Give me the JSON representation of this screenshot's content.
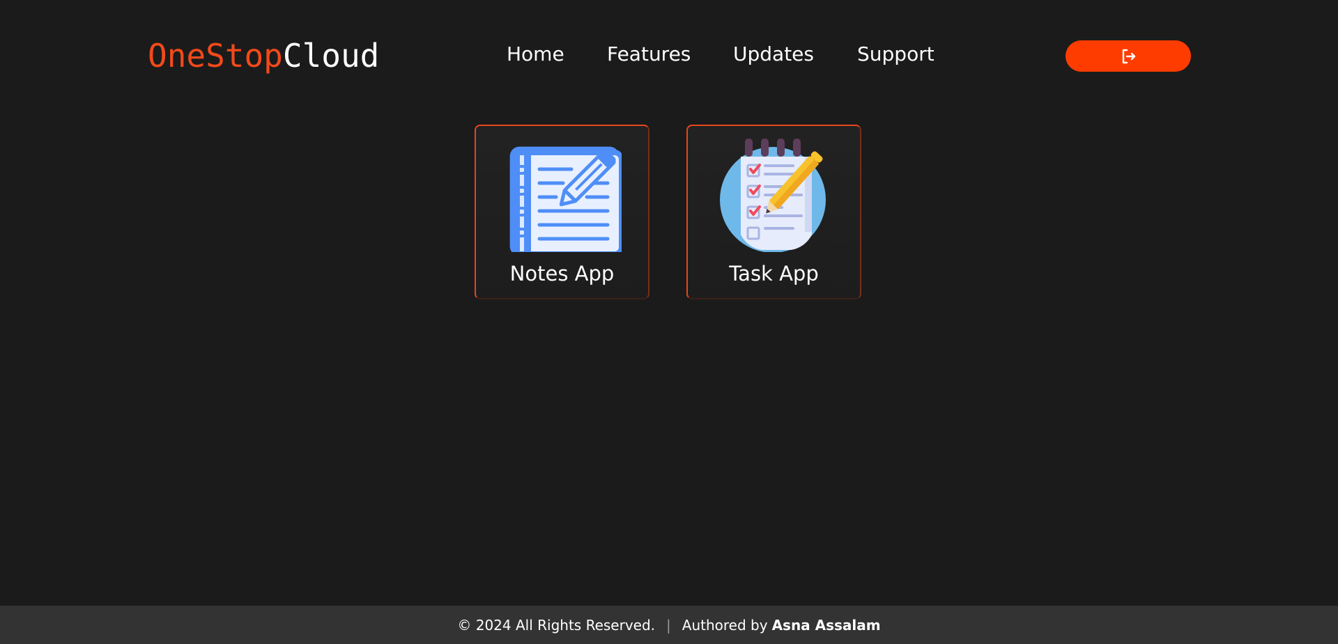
{
  "header": {
    "logo_part1": "OneStop",
    "logo_part2": "Cloud",
    "nav": [
      {
        "label": "Home"
      },
      {
        "label": "Features"
      },
      {
        "label": "Updates"
      },
      {
        "label": "Support"
      }
    ],
    "logout_icon": "logout-icon"
  },
  "apps": [
    {
      "label": "Notes App",
      "icon": "notebook-pencil-icon"
    },
    {
      "label": "Task App",
      "icon": "checklist-pencil-icon"
    }
  ],
  "footer": {
    "copyright": "© 2024 All Rights Reserved.",
    "separator": "|",
    "authored_by": "Authored by",
    "author": "Asna Assalam"
  },
  "colors": {
    "background": "#1b1b1b",
    "accent": "#ff3c00",
    "logo_accent": "#f24a1a",
    "footer_bg": "#333333"
  }
}
